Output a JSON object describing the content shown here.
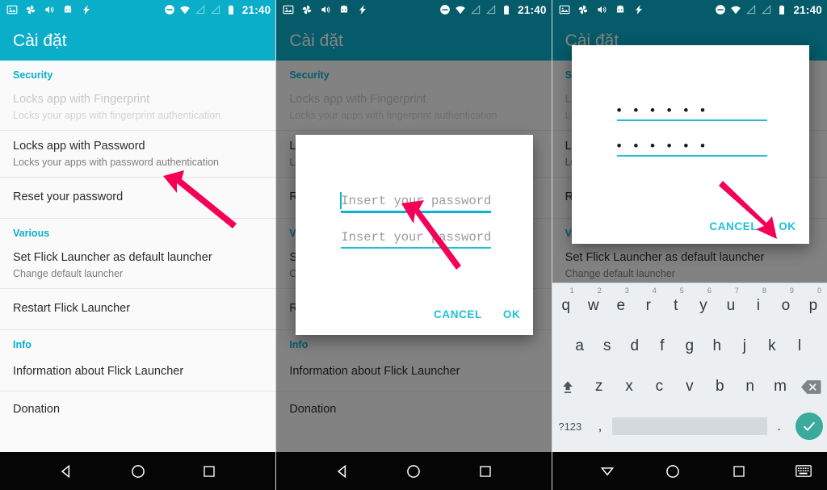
{
  "meta": {
    "accent": "#0aaec9",
    "dialog_button_color": "#1ec0d8",
    "arrow_color": "#f50057",
    "keyboard_bg": "#eceff1",
    "enter_key_color": "#3aaa9c",
    "scrim": "rgba(0,0,0,0.48)"
  },
  "statusbar": {
    "clock": "21:40",
    "left_icons": [
      "image-icon",
      "photos-pinwheel-icon",
      "volume-icon",
      "cyanogenmod-robot-icon",
      "lightning-bolt-icon"
    ],
    "right_icons": [
      "do-not-disturb-icon",
      "wifi-icon",
      "signal-empty-icon",
      "signal-empty-icon-2",
      "battery-full-icon"
    ]
  },
  "appbar": {
    "title": "Cài đặt"
  },
  "settings_list": {
    "sections": [
      {
        "header": "Security",
        "rows": [
          {
            "title": "Locks app with Fingerprint",
            "subtitle": "Locks your apps with fingerprint authentication",
            "disabled": true
          },
          {
            "title": "Locks app with Password",
            "subtitle": "Locks your apps with password authentication",
            "disabled": false
          },
          {
            "title": "Reset your password",
            "subtitle": "",
            "disabled": false
          }
        ]
      },
      {
        "header": "Various",
        "rows": [
          {
            "title": "Set Flick Launcher as default launcher",
            "subtitle": "Change default launcher",
            "disabled": false
          },
          {
            "title": "Restart Flick Launcher",
            "subtitle": "",
            "disabled": false
          }
        ]
      },
      {
        "header": "Info",
        "rows": [
          {
            "title": "Information about Flick Launcher",
            "subtitle": "",
            "disabled": false
          },
          {
            "title": "Donation",
            "subtitle": "",
            "disabled": false
          }
        ]
      }
    ]
  },
  "password_dialog_empty": {
    "field1_placeholder": "Insert your password",
    "field2_placeholder": "Insert your password",
    "field1_value": "",
    "field2_value": "",
    "cancel_label": "CANCEL",
    "ok_label": "OK"
  },
  "password_dialog_filled": {
    "field1_value": "• • • • • •",
    "field2_value": "• • • • • •",
    "field1_length": 6,
    "field2_length": 6,
    "cancel_label": "CANCEL",
    "ok_label": "OK"
  },
  "keyboard": {
    "row1": [
      {
        "key": "q",
        "num": "1"
      },
      {
        "key": "w",
        "num": "2"
      },
      {
        "key": "e",
        "num": "3"
      },
      {
        "key": "r",
        "num": "4"
      },
      {
        "key": "t",
        "num": "5"
      },
      {
        "key": "y",
        "num": "6"
      },
      {
        "key": "u",
        "num": "7"
      },
      {
        "key": "i",
        "num": "8"
      },
      {
        "key": "o",
        "num": "9"
      },
      {
        "key": "p",
        "num": "0"
      }
    ],
    "row2": [
      "a",
      "s",
      "d",
      "f",
      "g",
      "h",
      "j",
      "k",
      "l"
    ],
    "row3": [
      "z",
      "x",
      "c",
      "v",
      "b",
      "n",
      "m"
    ],
    "shift_icon": "shift-icon",
    "delete_icon": "backspace-icon",
    "symbols_label": "?123",
    "comma_label": ",",
    "period_label": ".",
    "space_label": "",
    "enter_icon": "check-icon"
  },
  "navbar": {
    "back_icon": "back-triangle-icon",
    "home_icon": "home-circle-icon",
    "recents_icon": "recents-square-icon",
    "back_down_icon": "dismiss-keyboard-down-triangle-icon",
    "ime_icon": "keyboard-switch-icon"
  },
  "annotations": {
    "arrow1": "arrow-pointing-to-locks-app-with-password",
    "arrow2": "arrow-pointing-to-first-password-field",
    "arrow3": "arrow-pointing-to-ok-button"
  }
}
